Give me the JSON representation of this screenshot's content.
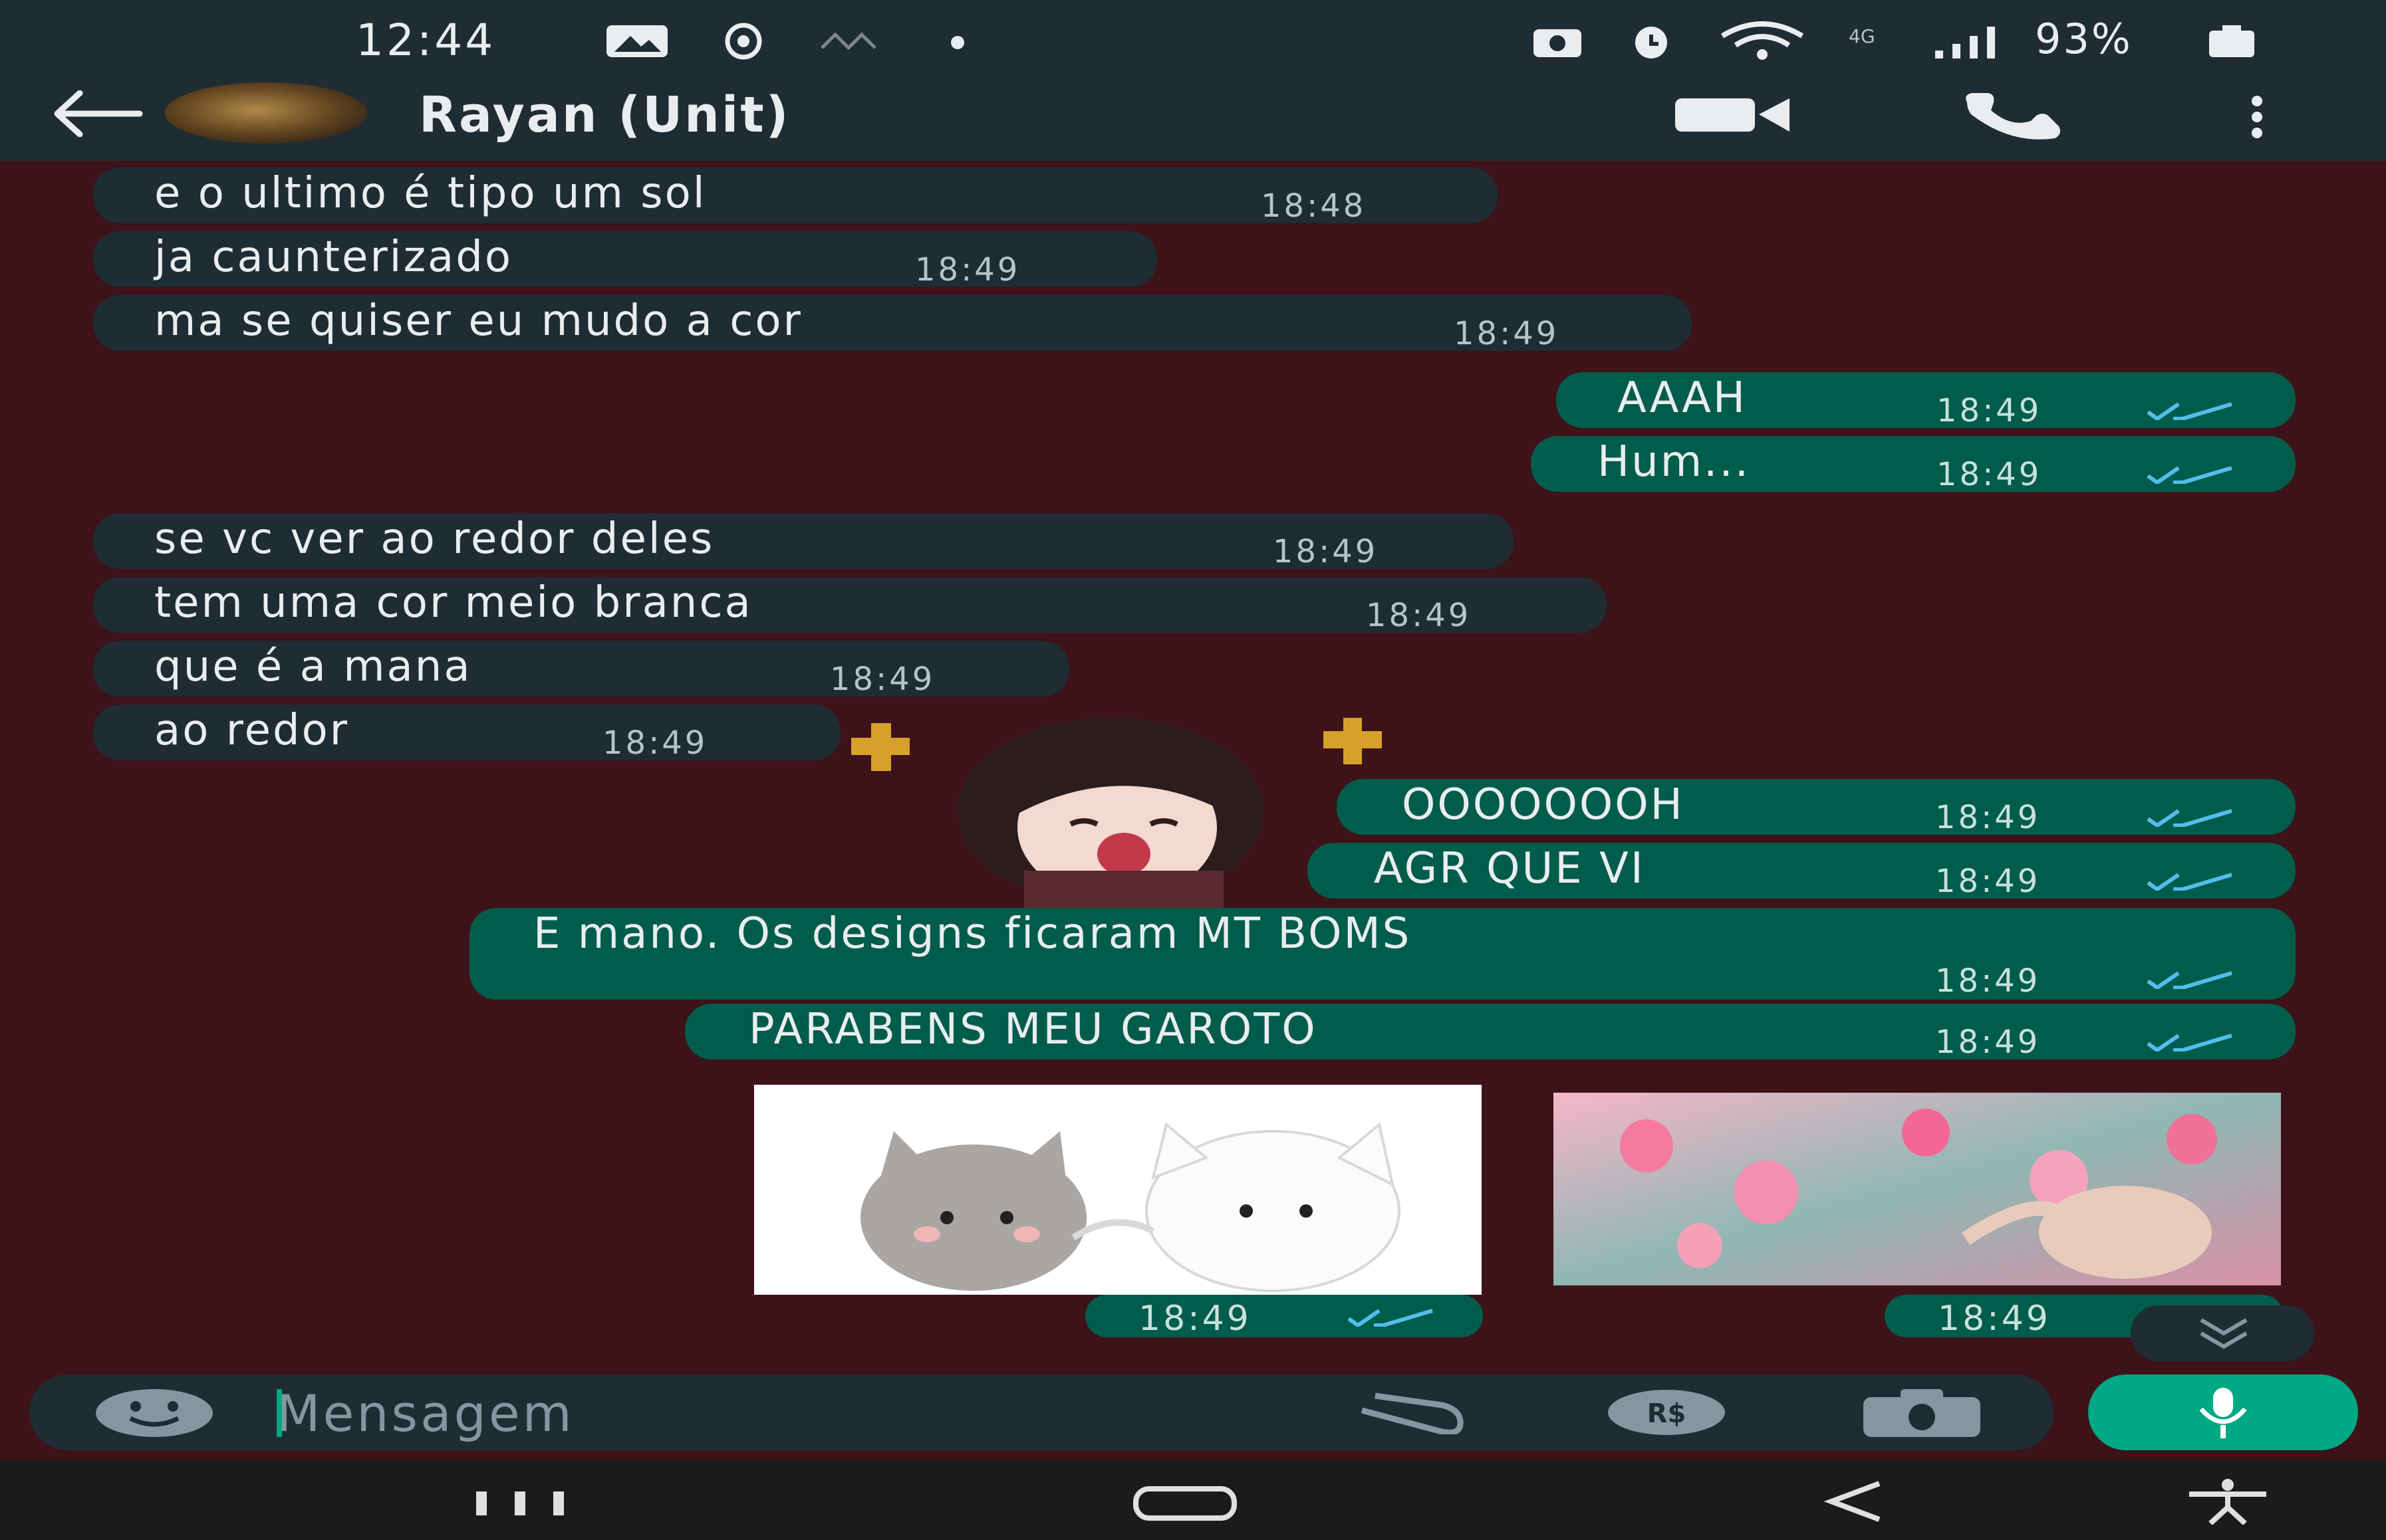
{
  "status_bar": {
    "time": "12:44",
    "network": "4G",
    "battery": "93%"
  },
  "header": {
    "contact_name": "Rayan (Unit)"
  },
  "messages": [
    {
      "dir": "in",
      "text": "e o ultimo é tipo um sol",
      "time": "18:48"
    },
    {
      "dir": "in",
      "text": "ja caunterizado",
      "time": "18:49"
    },
    {
      "dir": "in",
      "text": "ma se quiser eu mudo a cor",
      "time": "18:49"
    },
    {
      "dir": "out",
      "text": "AAAH",
      "time": "18:49"
    },
    {
      "dir": "out",
      "text": "Hum...",
      "time": "18:49"
    },
    {
      "dir": "in",
      "text": "se vc ver ao redor deles",
      "time": "18:49"
    },
    {
      "dir": "in",
      "text": "tem uma cor meio branca",
      "time": "18:49"
    },
    {
      "dir": "in",
      "text": "que é a mana",
      "time": "18:49"
    },
    {
      "dir": "in",
      "text": "ao redor",
      "time": "18:49"
    },
    {
      "dir": "out",
      "text": "OOOOOOOH",
      "time": "18:49"
    },
    {
      "dir": "out",
      "text": "AGR QUE VI",
      "time": "18:49"
    },
    {
      "dir": "out",
      "text": "E mano. Os designs ficaram MT BOMS",
      "time": "18:49"
    },
    {
      "dir": "out",
      "text": "PARABENS MEU GAROTO",
      "time": "18:49"
    }
  ],
  "media": [
    {
      "kind": "sticker-cats",
      "time": "18:49"
    },
    {
      "kind": "image-flowers",
      "time": "18:49"
    }
  ],
  "composer": {
    "placeholder": "Mensagem"
  },
  "icons": {
    "back": "arrow-left-icon",
    "video": "video-call-icon",
    "call": "phone-icon",
    "menu": "more-vert-icon",
    "emoji": "emoji-icon",
    "attach": "paperclip-icon",
    "payment": "rs-payment-icon",
    "camera": "camera-icon",
    "mic": "microphone-icon",
    "scroll": "double-chevron-down-icon",
    "nav_recents": "recents-icon",
    "nav_home": "home-icon",
    "nav_back": "nav-back-icon",
    "nav_accessibility": "accessibility-icon"
  },
  "colors": {
    "wallpaper": "#3d1218",
    "incoming": "#1f2c33",
    "outgoing": "#005c4b",
    "accent": "#00a884",
    "read_ticks": "#53bdeb"
  }
}
